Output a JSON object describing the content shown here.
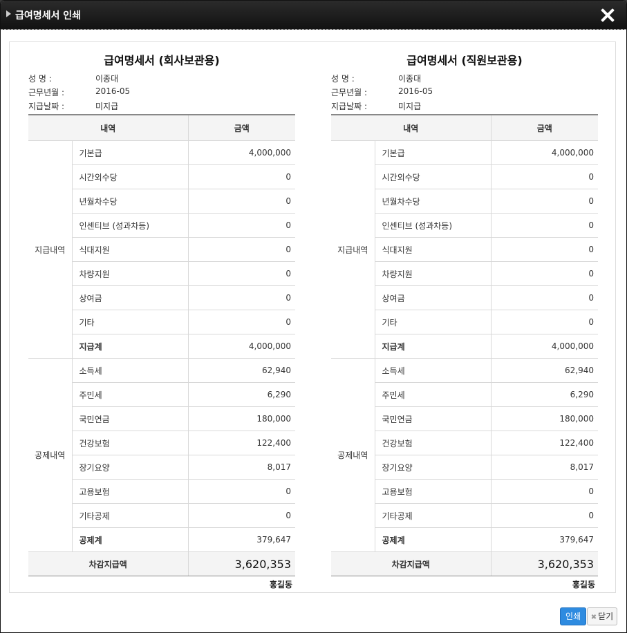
{
  "window": {
    "title": "급여명세서 인쇄"
  },
  "slips": [
    {
      "title": "급여명세서 (회사보관용)",
      "info": [
        {
          "key": "성      명 :",
          "value": "이종대"
        },
        {
          "key": "근무년월 :",
          "value": "2016-05"
        },
        {
          "key": "지급날짜 :",
          "value": "미지급"
        }
      ],
      "headers": {
        "item": "내역",
        "amount": "금액"
      },
      "payments": {
        "group": "지급내역",
        "rows": [
          {
            "label": "기본급",
            "amount": "4,000,000"
          },
          {
            "label": "시간외수당",
            "amount": "0"
          },
          {
            "label": "년월차수당",
            "amount": "0"
          },
          {
            "label": "인센티브 (성과차등)",
            "amount": "0"
          },
          {
            "label": "식대지원",
            "amount": "0"
          },
          {
            "label": "차량지원",
            "amount": "0"
          },
          {
            "label": "상여금",
            "amount": "0"
          },
          {
            "label": "기타",
            "amount": "0"
          }
        ],
        "total_label": "지급계",
        "total": "4,000,000"
      },
      "deductions": {
        "group": "공제내역",
        "rows": [
          {
            "label": "소득세",
            "amount": "62,940"
          },
          {
            "label": "주민세",
            "amount": "6,290"
          },
          {
            "label": "국민연금",
            "amount": "180,000"
          },
          {
            "label": "건강보험",
            "amount": "122,400"
          },
          {
            "label": "장기요양",
            "amount": "8,017"
          },
          {
            "label": "고용보험",
            "amount": "0"
          },
          {
            "label": "기타공제",
            "amount": "0"
          }
        ],
        "total_label": "공제계",
        "total": "379,647"
      },
      "net_label": "차감지급액",
      "net": "3,620,353",
      "signer": "홍길동"
    },
    {
      "title": "급여명세서 (직원보관용)",
      "info": [
        {
          "key": "성      명 :",
          "value": "이종대"
        },
        {
          "key": "근무년월 :",
          "value": "2016-05"
        },
        {
          "key": "지급날짜 :",
          "value": "미지급"
        }
      ],
      "headers": {
        "item": "내역",
        "amount": "금액"
      },
      "payments": {
        "group": "지급내역",
        "rows": [
          {
            "label": "기본급",
            "amount": "4,000,000"
          },
          {
            "label": "시간외수당",
            "amount": "0"
          },
          {
            "label": "년월차수당",
            "amount": "0"
          },
          {
            "label": "인센티브 (성과차등)",
            "amount": "0"
          },
          {
            "label": "식대지원",
            "amount": "0"
          },
          {
            "label": "차량지원",
            "amount": "0"
          },
          {
            "label": "상여금",
            "amount": "0"
          },
          {
            "label": "기타",
            "amount": "0"
          }
        ],
        "total_label": "지급계",
        "total": "4,000,000"
      },
      "deductions": {
        "group": "공제내역",
        "rows": [
          {
            "label": "소득세",
            "amount": "62,940"
          },
          {
            "label": "주민세",
            "amount": "6,290"
          },
          {
            "label": "국민연금",
            "amount": "180,000"
          },
          {
            "label": "건강보험",
            "amount": "122,400"
          },
          {
            "label": "장기요양",
            "amount": "8,017"
          },
          {
            "label": "고용보험",
            "amount": "0"
          },
          {
            "label": "기타공제",
            "amount": "0"
          }
        ],
        "total_label": "공제계",
        "total": "379,647"
      },
      "net_label": "차감지급액",
      "net": "3,620,353",
      "signer": "홍길동"
    }
  ],
  "buttons": {
    "print": "인쇄",
    "close": "닫기"
  },
  "icons": {
    "title_marker": "triangle-right-icon",
    "close": "close-icon",
    "close_button": "x-icon"
  },
  "colors": {
    "titlebar": "#1a1a1a",
    "primary_button": "#2e8be0"
  }
}
